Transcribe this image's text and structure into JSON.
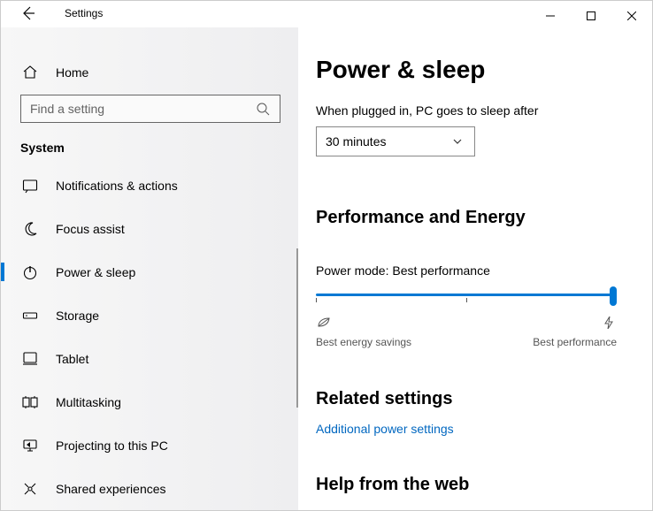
{
  "appTitle": "Settings",
  "sidebar": {
    "home": "Home",
    "searchPlaceholder": "Find a setting",
    "section": "System",
    "items": [
      {
        "label": "Notifications & actions"
      },
      {
        "label": "Focus assist"
      },
      {
        "label": "Power & sleep"
      },
      {
        "label": "Storage"
      },
      {
        "label": "Tablet"
      },
      {
        "label": "Multitasking"
      },
      {
        "label": "Projecting to this PC"
      },
      {
        "label": "Shared experiences"
      }
    ]
  },
  "main": {
    "title": "Power & sleep",
    "sleepLabel": "When plugged in, PC goes to sleep after",
    "sleepValue": "30 minutes",
    "perfHeading": "Performance and Energy",
    "powerModePrefix": "Power mode: ",
    "powerModeValue": "Best performance",
    "sliderMinLabel": "Best energy savings",
    "sliderMaxLabel": "Best performance",
    "relatedHeading": "Related settings",
    "relatedLink": "Additional power settings",
    "helpHeading": "Help from the web"
  }
}
